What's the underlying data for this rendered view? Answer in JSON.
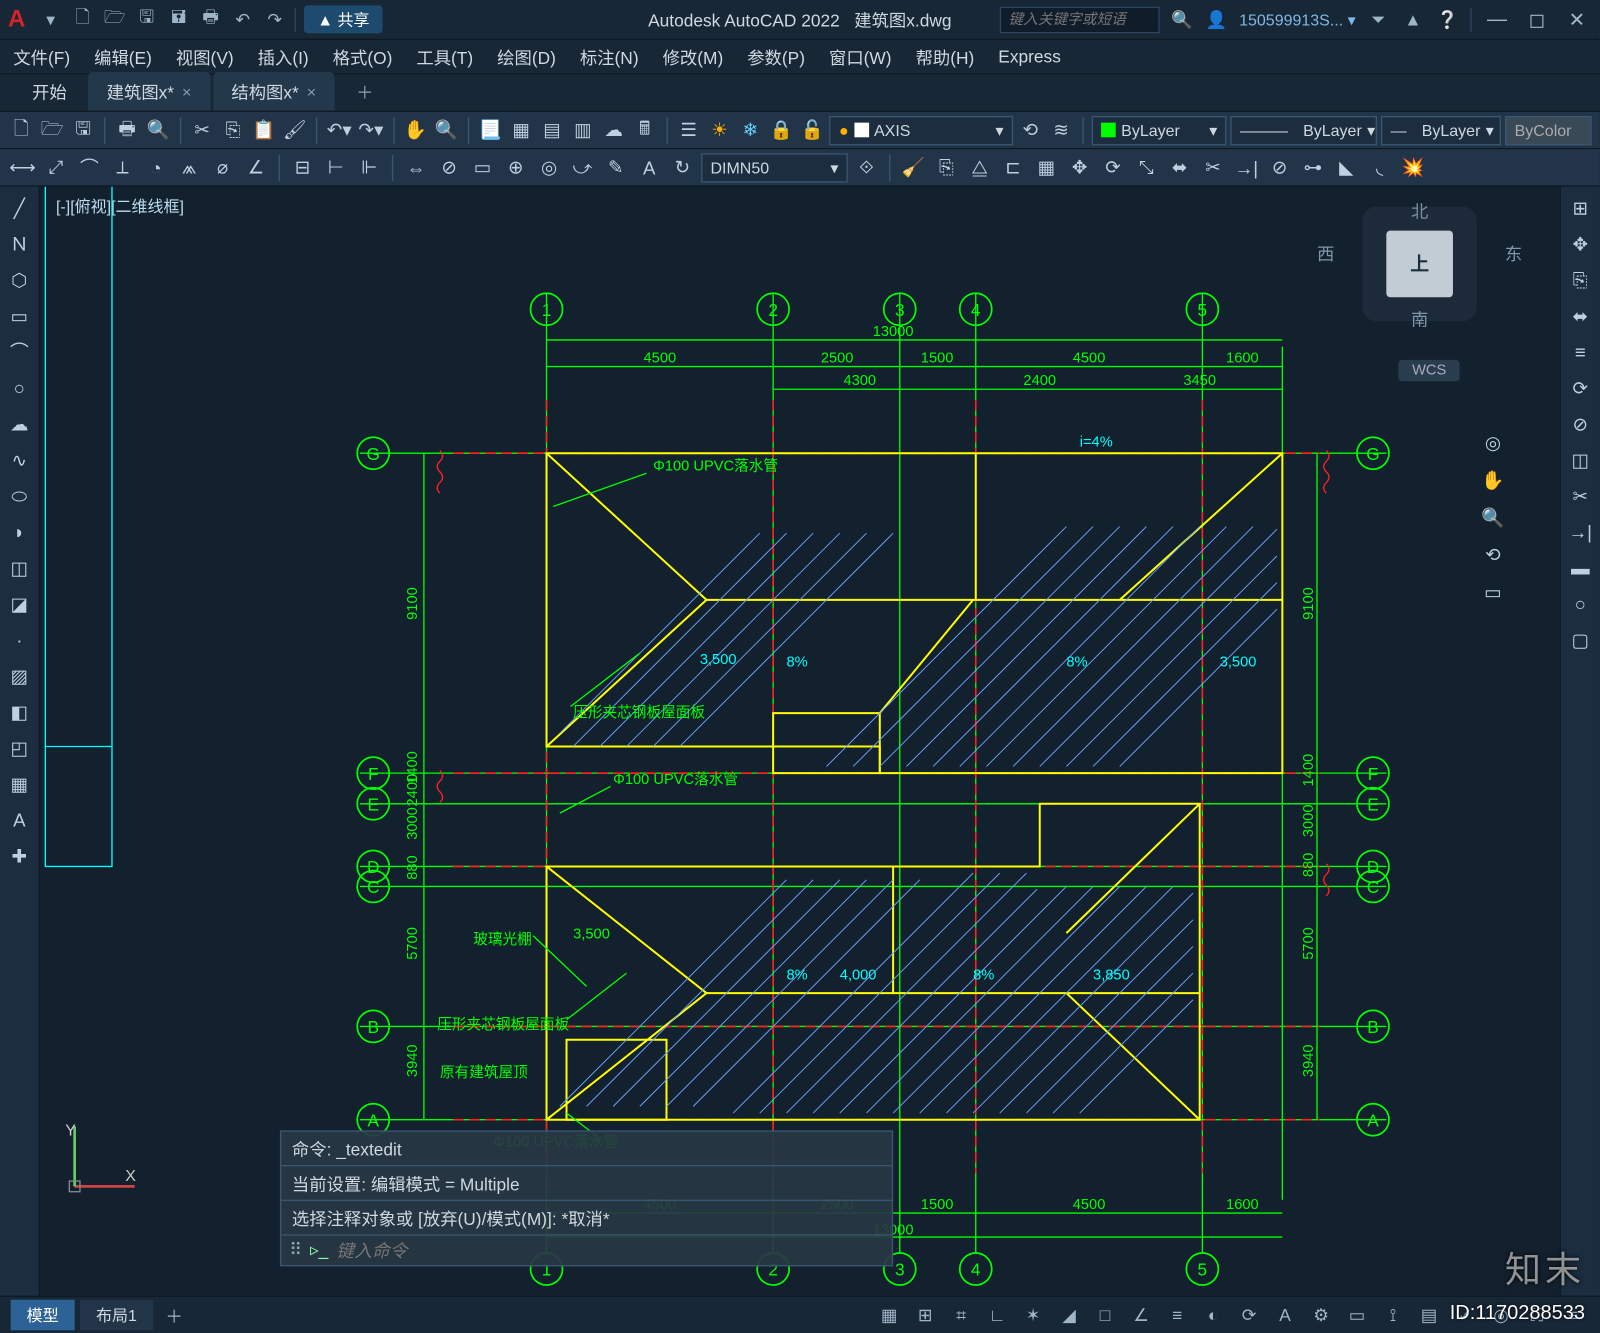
{
  "titlebar": {
    "app_title": "Autodesk AutoCAD 2022",
    "doc_name": "建筑图x.dwg",
    "share": "共享",
    "search_ph": "键入关键字或短语",
    "user": "150599913S... ▾"
  },
  "menu": [
    "文件(F)",
    "编辑(E)",
    "视图(V)",
    "插入(I)",
    "格式(O)",
    "工具(T)",
    "绘图(D)",
    "标注(N)",
    "修改(M)",
    "参数(P)",
    "窗口(W)",
    "帮助(H)",
    "Express"
  ],
  "tabs": {
    "start": "开始",
    "doc1": "建筑图x*",
    "doc2": "结构图x*"
  },
  "layers": {
    "layer_name": "AXIS",
    "bylayer": "ByLayer",
    "bycolor": "ByColor",
    "dim_style": "DIMN50"
  },
  "view": {
    "label": "[-][俯视][二维线框]",
    "cube_top": "上",
    "n": "北",
    "s": "南",
    "e": "东",
    "w": "西",
    "wcs": "WCS"
  },
  "cmd": {
    "h1": "命令: _textedit",
    "h2": "当前设置: 编辑模式 = Multiple",
    "h3": "选择注释对象或 [放弃(U)/模式(M)]: *取消*",
    "ph": "键入命令"
  },
  "status": {
    "model": "模型",
    "layout1": "布局1"
  },
  "grid": {
    "cols": [
      "1",
      "2",
      "3",
      "4",
      "5"
    ],
    "rows": [
      "A",
      "B",
      "C",
      "D",
      "E",
      "F",
      "G"
    ]
  },
  "dims": {
    "top_total": "13000",
    "top": [
      "4500",
      "2500",
      "1500",
      "4500",
      "1600"
    ],
    "top2": [
      "4300",
      "2400",
      "3450"
    ],
    "bot_total": "13000",
    "bot": [
      "4500",
      "2500",
      "1500",
      "4500",
      "1600"
    ],
    "left_vals": [
      "3940",
      "5700",
      "880",
      "3000",
      "2400",
      "1400",
      "9100"
    ],
    "r_val1": "9100",
    "r_val2": "1400",
    "r_val3": "3000",
    "r_val4": "880",
    "r_val5": "5700",
    "r_val6": "3940",
    "slope": "8%",
    "h1": "3,500",
    "h2": "3,500",
    "h3": "4,000",
    "h4": "3,850",
    "h5": "3,500",
    "slope_i": "i=4%"
  },
  "ann": {
    "pipe": "Φ100 UPVC落水管",
    "panel": "压形夹芯钢板屋面板",
    "glass": "玻璃光棚",
    "orig": "原有建筑屋顶"
  },
  "watermark": "知末",
  "id": "ID:1170288533"
}
